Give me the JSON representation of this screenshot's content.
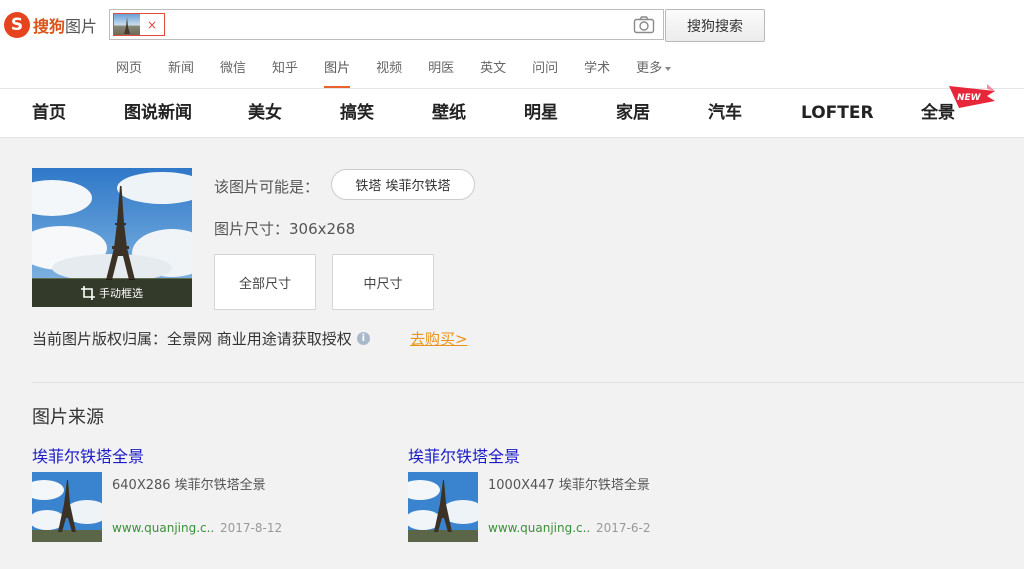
{
  "logo": {
    "brand": "搜狗",
    "product": "图片"
  },
  "search": {
    "query_chip_close": "×",
    "button_label": "搜狗搜索"
  },
  "tabs": [
    {
      "label": "网页"
    },
    {
      "label": "新闻"
    },
    {
      "label": "微信"
    },
    {
      "label": "知乎"
    },
    {
      "label": "图片",
      "active": true
    },
    {
      "label": "视频"
    },
    {
      "label": "明医"
    },
    {
      "label": "英文"
    },
    {
      "label": "问问"
    },
    {
      "label": "学术"
    },
    {
      "label": "更多"
    }
  ],
  "categories": [
    "首页",
    "图说新闻",
    "美女",
    "搞笑",
    "壁纸",
    "明星",
    "家居",
    "汽车",
    "LOFTER",
    "全景"
  ],
  "new_badge": "NEW",
  "preview": {
    "crop_label": "手动框选"
  },
  "result": {
    "maybe_label": "该图片可能是：",
    "maybe_tag": "铁塔 埃菲尔铁塔",
    "size_label": "图片尺寸：306x268",
    "size_buttons": [
      "全部尺寸",
      "中尺寸"
    ],
    "copyright": "当前图片版权归属：全景网 商业用途请获取授权",
    "info_icon": "i",
    "buy_link": "去购买>"
  },
  "sources": {
    "title": "图片来源",
    "items": [
      {
        "title": "埃菲尔铁塔全景",
        "desc": "640X286 埃菲尔铁塔全景",
        "url": "www.quanjing.c..",
        "date": "2017-8-12"
      },
      {
        "title": "埃菲尔铁塔全景",
        "desc": "1000X447 埃菲尔铁塔全景",
        "url": "www.quanjing.c..",
        "date": "2017-6-2"
      }
    ]
  },
  "colors": {
    "brand": "#e6431f",
    "tab_active_underline": "#e8622f",
    "buy_link": "#e99419",
    "source_link": "#1a1ac8",
    "source_url": "#3c8f3c"
  }
}
